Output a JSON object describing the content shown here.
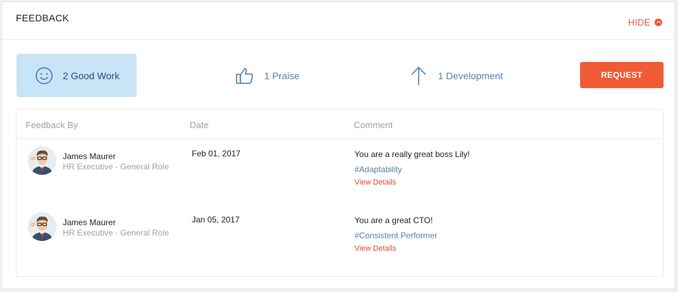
{
  "header": {
    "title": "FEEDBACK",
    "hide_label": "HIDE"
  },
  "tabs": [
    {
      "label": "2 Good Work",
      "icon": "smiley-icon"
    },
    {
      "label": "1 Praise",
      "icon": "thumbs-up-icon"
    },
    {
      "label": "1 Development",
      "icon": "arrow-up-icon"
    }
  ],
  "request_label": "REQUEST",
  "table": {
    "columns": [
      "Feedback By",
      "Date",
      "Comment"
    ],
    "rows": [
      {
        "name": "James Maurer",
        "role": "HR Executive - General Role",
        "date": "Feb 01, 2017",
        "comment": "You are a really great boss Lily!",
        "tag": "#Adaptability",
        "link": "View Details"
      },
      {
        "name": "James Maurer",
        "role": "HR Executive - General Role",
        "date": "Jan 05, 2017",
        "comment": "You are a great CTO!",
        "tag": "#Consistent Performer",
        "link": "View Details"
      }
    ]
  },
  "colors": {
    "accent": "#f05a35",
    "active_tab_bg": "#c9e3f7",
    "link_blue": "#5a7fa6"
  }
}
